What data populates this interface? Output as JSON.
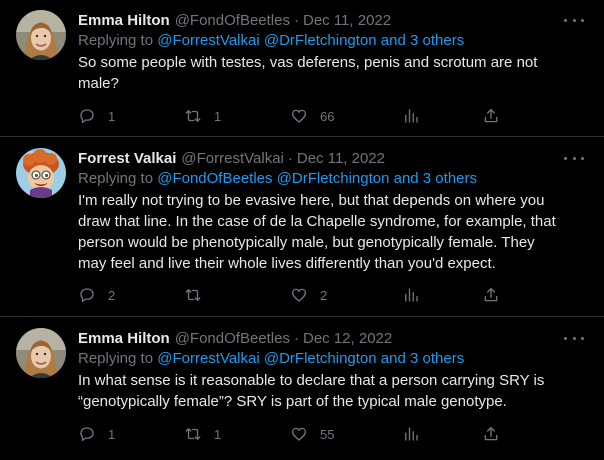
{
  "tweets": [
    {
      "name": "Emma Hilton",
      "handle": "@FondOfBeetles",
      "separator": "·",
      "date": "Dec 11, 2022",
      "replying_prefix": "Replying to",
      "replying_mentions": "@ForrestValkai @DrFletchington and 3 others",
      "text_lines": [
        "So some people with testes, vas deferens, penis and scrotum are not",
        "male?"
      ],
      "replies": "1",
      "retweets": "1",
      "likes": "66",
      "avatar": "woman-photo-avatar"
    },
    {
      "name": "Forrest Valkai",
      "handle": "@ForrestValkai",
      "separator": "·",
      "date": "Dec 11, 2022",
      "replying_prefix": "Replying to",
      "replying_mentions": "@FondOfBeetles @DrFletchington and 3 others",
      "text_lines": [
        "I'm really not trying to be evasive here, but that depends on where you",
        "draw that line. In the case of de la Chapelle syndrome, for example, that",
        "person would be phenotypically male, but genotypically female. They",
        "may feel and live their whole lives differently than you'd expect."
      ],
      "replies": "2",
      "retweets": "",
      "likes": "2",
      "avatar": "cartoon-redhead-avatar"
    },
    {
      "name": "Emma Hilton",
      "handle": "@FondOfBeetles",
      "separator": "·",
      "date": "Dec 12, 2022",
      "replying_prefix": "Replying to",
      "replying_mentions": "@ForrestValkai @DrFletchington and 3 others",
      "text_lines": [
        "In what sense is it reasonable to declare that a person carrying SRY is",
        "“genotypically female”? SRY is part of the typical male genotype."
      ],
      "replies": "1",
      "retweets": "1",
      "likes": "55",
      "avatar": "woman-photo-avatar"
    }
  ],
  "icons": [
    "reply-icon",
    "retweet-icon",
    "like-icon",
    "views-icon",
    "share-icon",
    "more-icon"
  ],
  "colors": {
    "background": "#000000",
    "text": "#e7e9ea",
    "muted": "#71767b",
    "link": "#1d9bf0",
    "divider": "#2f3336"
  }
}
